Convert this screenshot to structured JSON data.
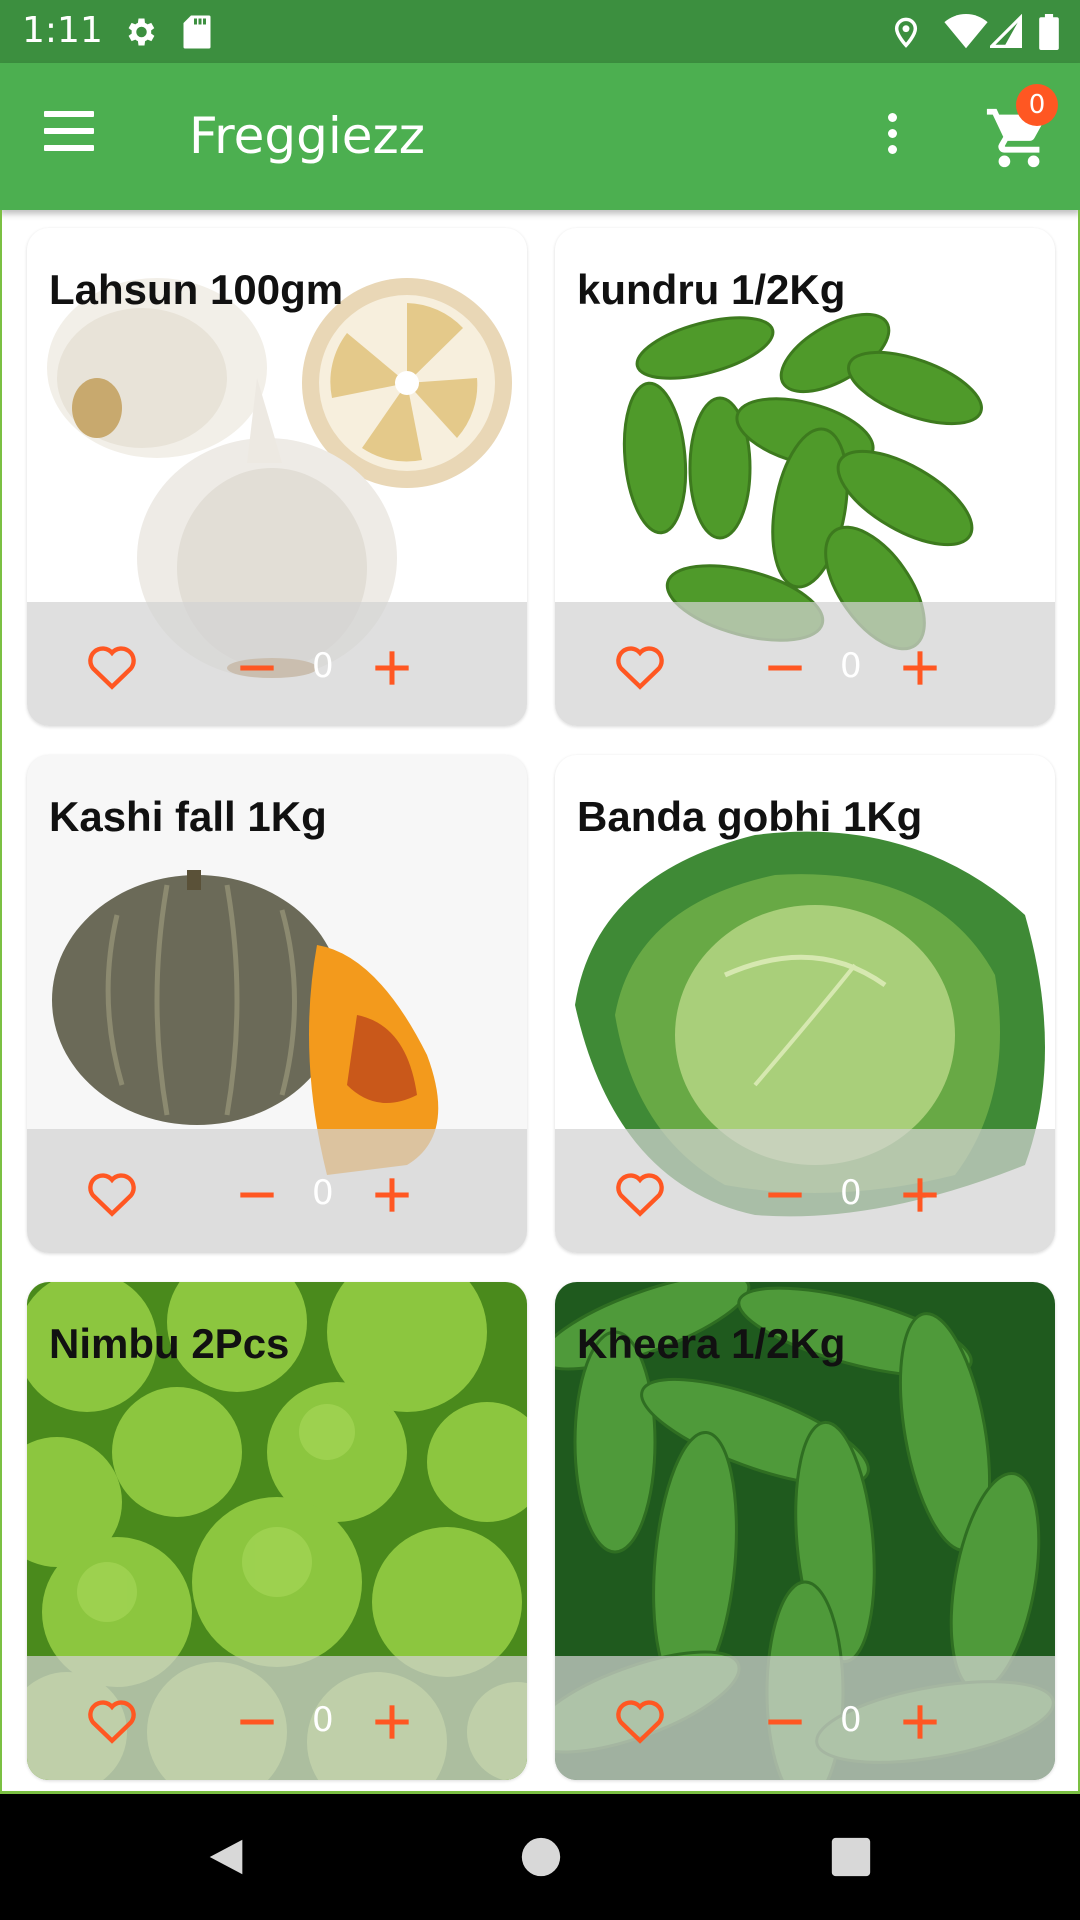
{
  "status_bar": {
    "time": "1:11"
  },
  "app_bar": {
    "title": "Freggiezz",
    "cart_count": "0"
  },
  "products": [
    {
      "name": "Lahsun 100gm",
      "qty": "0"
    },
    {
      "name": "kundru 1/2Kg",
      "qty": "0"
    },
    {
      "name": "Kashi fall 1Kg",
      "qty": "0"
    },
    {
      "name": "Banda gobhi 1Kg",
      "qty": "0"
    },
    {
      "name": "Nimbu 2Pcs",
      "qty": "0"
    },
    {
      "name": "Kheera 1/2Kg",
      "qty": "0"
    }
  ],
  "colors": {
    "primary": "#4caf50",
    "primary_dark": "#3c8f3f",
    "accent": "#ff5722"
  }
}
